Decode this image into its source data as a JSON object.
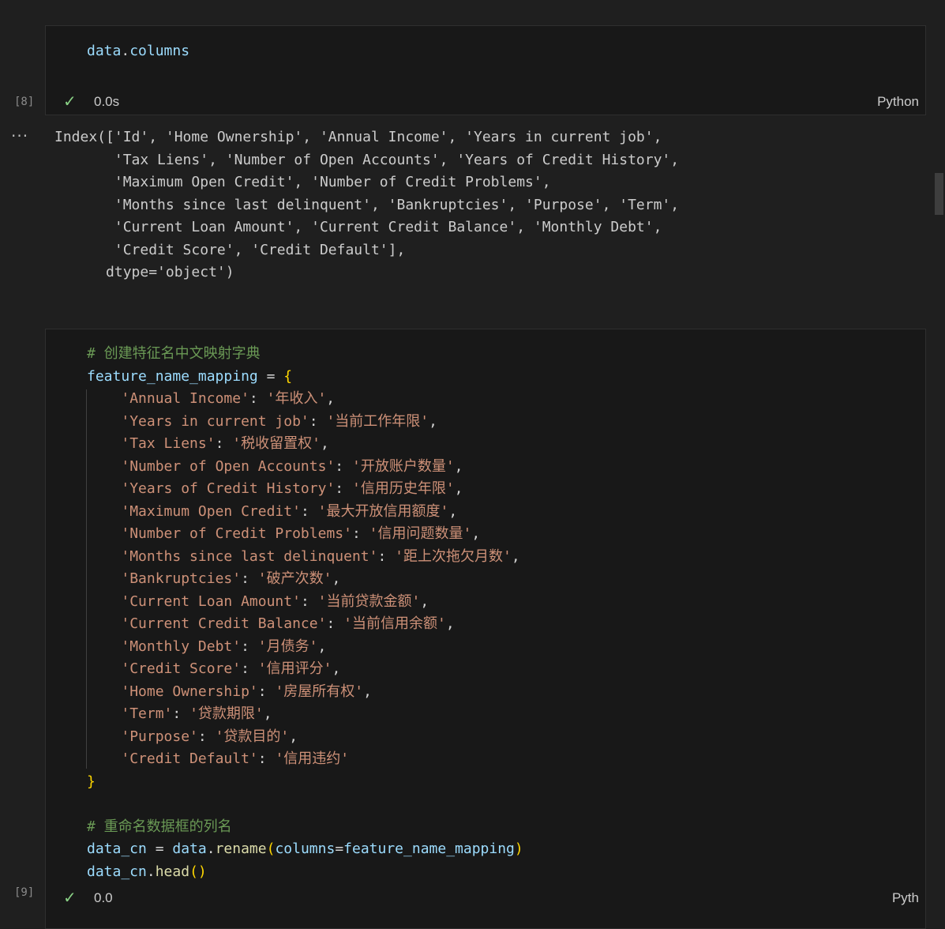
{
  "cell8": {
    "exec_count": "[8]",
    "code": [
      [
        {
          "t": "data",
          "c": "k"
        },
        {
          "t": ".",
          "c": "p"
        },
        {
          "t": "columns",
          "c": "k"
        }
      ]
    ],
    "status_icon": "check-icon",
    "time": "0.0s",
    "language": "Python"
  },
  "output8": {
    "menu_icon": "ellipsis-icon",
    "text": "Index(['Id', 'Home Ownership', 'Annual Income', 'Years in current job',\n       'Tax Liens', 'Number of Open Accounts', 'Years of Credit History',\n       'Maximum Open Credit', 'Number of Credit Problems',\n       'Months since last delinquent', 'Bankruptcies', 'Purpose', 'Term',\n       'Current Loan Amount', 'Current Credit Balance', 'Monthly Debt',\n       'Credit Score', 'Credit Default'],\n      dtype='object')"
  },
  "cell9": {
    "exec_count": "[9]",
    "code": [
      [
        {
          "t": "# 创建特征名中文映射字典",
          "c": "c"
        }
      ],
      [
        {
          "t": "feature_name_mapping",
          "c": "k"
        },
        {
          "t": " = ",
          "c": "p"
        },
        {
          "t": "{",
          "c": "b"
        }
      ],
      [
        {
          "t": "    ",
          "c": "p"
        },
        {
          "t": "'Annual Income'",
          "c": "s"
        },
        {
          "t": ": ",
          "c": "p"
        },
        {
          "t": "'年收入'",
          "c": "s"
        },
        {
          "t": ",",
          "c": "p"
        }
      ],
      [
        {
          "t": "    ",
          "c": "p"
        },
        {
          "t": "'Years in current job'",
          "c": "s"
        },
        {
          "t": ": ",
          "c": "p"
        },
        {
          "t": "'当前工作年限'",
          "c": "s"
        },
        {
          "t": ",",
          "c": "p"
        }
      ],
      [
        {
          "t": "    ",
          "c": "p"
        },
        {
          "t": "'Tax Liens'",
          "c": "s"
        },
        {
          "t": ": ",
          "c": "p"
        },
        {
          "t": "'税收留置权'",
          "c": "s"
        },
        {
          "t": ",",
          "c": "p"
        }
      ],
      [
        {
          "t": "    ",
          "c": "p"
        },
        {
          "t": "'Number of Open Accounts'",
          "c": "s"
        },
        {
          "t": ": ",
          "c": "p"
        },
        {
          "t": "'开放账户数量'",
          "c": "s"
        },
        {
          "t": ",",
          "c": "p"
        }
      ],
      [
        {
          "t": "    ",
          "c": "p"
        },
        {
          "t": "'Years of Credit History'",
          "c": "s"
        },
        {
          "t": ": ",
          "c": "p"
        },
        {
          "t": "'信用历史年限'",
          "c": "s"
        },
        {
          "t": ",",
          "c": "p"
        }
      ],
      [
        {
          "t": "    ",
          "c": "p"
        },
        {
          "t": "'Maximum Open Credit'",
          "c": "s"
        },
        {
          "t": ": ",
          "c": "p"
        },
        {
          "t": "'最大开放信用额度'",
          "c": "s"
        },
        {
          "t": ",",
          "c": "p"
        }
      ],
      [
        {
          "t": "    ",
          "c": "p"
        },
        {
          "t": "'Number of Credit Problems'",
          "c": "s"
        },
        {
          "t": ": ",
          "c": "p"
        },
        {
          "t": "'信用问题数量'",
          "c": "s"
        },
        {
          "t": ",",
          "c": "p"
        }
      ],
      [
        {
          "t": "    ",
          "c": "p"
        },
        {
          "t": "'Months since last delinquent'",
          "c": "s"
        },
        {
          "t": ": ",
          "c": "p"
        },
        {
          "t": "'距上次拖欠月数'",
          "c": "s"
        },
        {
          "t": ",",
          "c": "p"
        }
      ],
      [
        {
          "t": "    ",
          "c": "p"
        },
        {
          "t": "'Bankruptcies'",
          "c": "s"
        },
        {
          "t": ": ",
          "c": "p"
        },
        {
          "t": "'破产次数'",
          "c": "s"
        },
        {
          "t": ",",
          "c": "p"
        }
      ],
      [
        {
          "t": "    ",
          "c": "p"
        },
        {
          "t": "'Current Loan Amount'",
          "c": "s"
        },
        {
          "t": ": ",
          "c": "p"
        },
        {
          "t": "'当前贷款金额'",
          "c": "s"
        },
        {
          "t": ",",
          "c": "p"
        }
      ],
      [
        {
          "t": "    ",
          "c": "p"
        },
        {
          "t": "'Current Credit Balance'",
          "c": "s"
        },
        {
          "t": ": ",
          "c": "p"
        },
        {
          "t": "'当前信用余额'",
          "c": "s"
        },
        {
          "t": ",",
          "c": "p"
        }
      ],
      [
        {
          "t": "    ",
          "c": "p"
        },
        {
          "t": "'Monthly Debt'",
          "c": "s"
        },
        {
          "t": ": ",
          "c": "p"
        },
        {
          "t": "'月债务'",
          "c": "s"
        },
        {
          "t": ",",
          "c": "p"
        }
      ],
      [
        {
          "t": "    ",
          "c": "p"
        },
        {
          "t": "'Credit Score'",
          "c": "s"
        },
        {
          "t": ": ",
          "c": "p"
        },
        {
          "t": "'信用评分'",
          "c": "s"
        },
        {
          "t": ",",
          "c": "p"
        }
      ],
      [
        {
          "t": "    ",
          "c": "p"
        },
        {
          "t": "'Home Ownership'",
          "c": "s"
        },
        {
          "t": ": ",
          "c": "p"
        },
        {
          "t": "'房屋所有权'",
          "c": "s"
        },
        {
          "t": ",",
          "c": "p"
        }
      ],
      [
        {
          "t": "    ",
          "c": "p"
        },
        {
          "t": "'Term'",
          "c": "s"
        },
        {
          "t": ": ",
          "c": "p"
        },
        {
          "t": "'贷款期限'",
          "c": "s"
        },
        {
          "t": ",",
          "c": "p"
        }
      ],
      [
        {
          "t": "    ",
          "c": "p"
        },
        {
          "t": "'Purpose'",
          "c": "s"
        },
        {
          "t": ": ",
          "c": "p"
        },
        {
          "t": "'贷款目的'",
          "c": "s"
        },
        {
          "t": ",",
          "c": "p"
        }
      ],
      [
        {
          "t": "    ",
          "c": "p"
        },
        {
          "t": "'Credit Default'",
          "c": "s"
        },
        {
          "t": ": ",
          "c": "p"
        },
        {
          "t": "'信用违约'",
          "c": "s"
        }
      ],
      [
        {
          "t": "}",
          "c": "b"
        }
      ],
      [
        {
          "t": "",
          "c": "p"
        }
      ],
      [
        {
          "t": "# 重命名数据框的列名",
          "c": "c"
        }
      ],
      [
        {
          "t": "data_cn",
          "c": "k"
        },
        {
          "t": " = ",
          "c": "p"
        },
        {
          "t": "data",
          "c": "k"
        },
        {
          "t": ".",
          "c": "p"
        },
        {
          "t": "rename",
          "c": "f"
        },
        {
          "t": "(",
          "c": "b"
        },
        {
          "t": "columns",
          "c": "k"
        },
        {
          "t": "=",
          "c": "p"
        },
        {
          "t": "feature_name_mapping",
          "c": "k"
        },
        {
          "t": ")",
          "c": "b"
        }
      ],
      [
        {
          "t": "data_cn",
          "c": "k"
        },
        {
          "t": ".",
          "c": "p"
        },
        {
          "t": "head",
          "c": "f"
        },
        {
          "t": "()",
          "c": "b"
        }
      ]
    ],
    "status_icon": "check-icon",
    "time": "0.0",
    "language": "Pyth"
  },
  "colors": {
    "background": "#1f1f1f",
    "cell_background": "#181818",
    "variable": "#9cdcfe",
    "string": "#ce9178",
    "comment": "#6a9955",
    "function": "#dcdcaa",
    "bracket": "#ffd700",
    "success": "#89d185"
  }
}
